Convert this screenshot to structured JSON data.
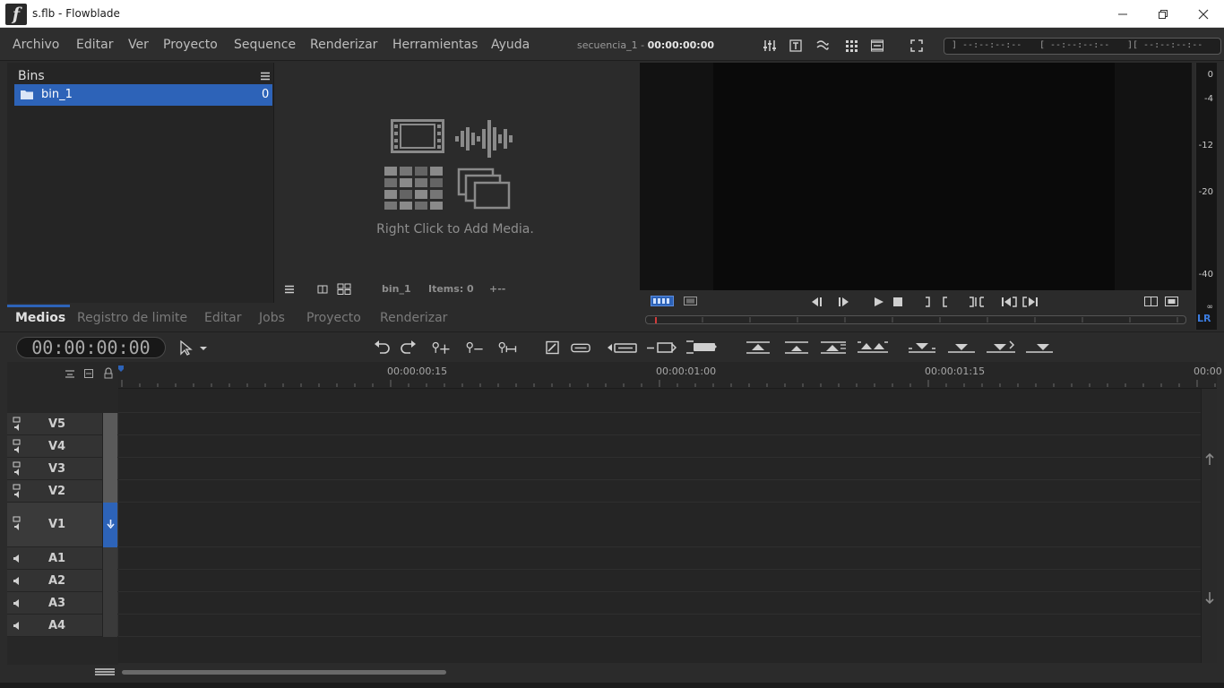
{
  "window": {
    "title": "s.flb - Flowblade"
  },
  "menu": [
    "Archivo",
    "Editar",
    "Ver",
    "Proyecto",
    "Sequence",
    "Renderizar",
    "Herramientas",
    "Ayuda"
  ],
  "sequence": {
    "name": "secuencia_1 - ",
    "time": "00:00:00:00"
  },
  "timecode_boxes": {
    "mark_out": "] --:--:--:--",
    "mark_in": "[ --:--:--:--",
    "length": "][ --:--:--:--"
  },
  "bins": {
    "title": "Bins",
    "items": [
      {
        "name": "bin_1",
        "count": "0"
      }
    ]
  },
  "media": {
    "hint": "Right Click to Add Media.",
    "footer_bin": "bin_1",
    "footer_items": "Items: 0",
    "footer_more": "+--"
  },
  "tabs": [
    "Medios",
    "Registro de limite",
    "Editar",
    "Jobs",
    "Proyecto",
    "Renderizar"
  ],
  "meter": {
    "labels": [
      "0",
      "-4",
      "-12",
      "-20",
      "-40"
    ],
    "inf": "∞",
    "lr": "LR"
  },
  "timeline": {
    "timecode": "00:00:00:00",
    "ruler": [
      "00:00:00:15",
      "00:00:01:00",
      "00:00:01:15",
      "00:00"
    ],
    "video_tracks": [
      "V5",
      "V4",
      "V3",
      "V2",
      "V1"
    ],
    "audio_tracks": [
      "A1",
      "A2",
      "A3",
      "A4"
    ]
  }
}
